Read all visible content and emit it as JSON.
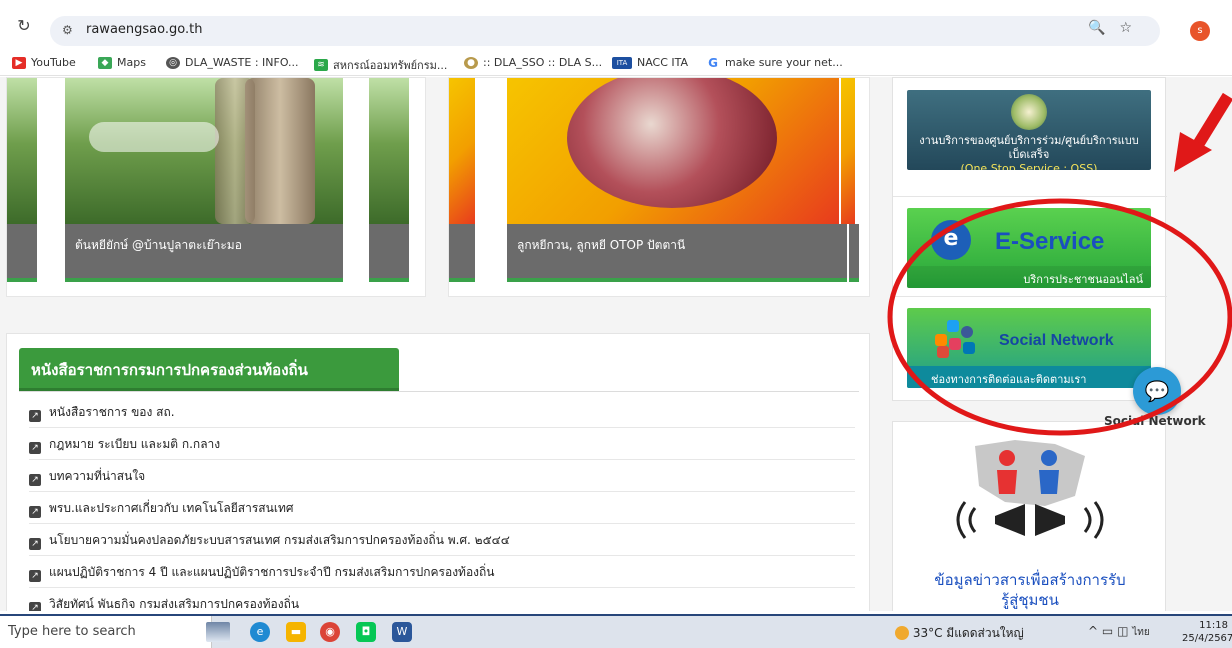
{
  "browser": {
    "url": "rawaengsao.go.th",
    "profile_initial": "s",
    "bookmarks": [
      "YouTube",
      "Maps",
      "DLA_WASTE : INFO...",
      "สหกรณ์ออมทรัพย์กรม...",
      ":: DLA_SSO :: DLA S...",
      "NACC ITA",
      "make sure your net..."
    ],
    "bookmark_badges": {
      "ita": "ITA",
      "google": "G"
    }
  },
  "cards": [
    {
      "caption": "ต้นหยียักษ์ @บ้านปูลาตะเย๊าะมอ"
    },
    {
      "caption": "ลูกหยีกวน, ลูกหยี OTOP ปัตตานี"
    }
  ],
  "panel": {
    "title": "หนังสือราชการกรมการปกครองส่วนท้องถิ่น",
    "items": [
      "หนังสือราชการ ของ สถ.",
      "กฎหมาย ระเบียบ และมติ ก.กลาง",
      "บทความที่น่าสนใจ",
      "พรบ.และประกาศเกี่ยวกับ เทคโนโลยีสารสนเทศ",
      "นโยบายความมั่นคงปลอดภัยระบบสารสนเทศ กรมส่งเสริมการปกครองท้องถิ่น พ.ศ. ๒๕๔๔",
      "แผนปฏิบัติราชการ 4 ปี และแผนปฏิบัติราชการประจำปี กรมส่งเสริมการปกครองท้องถิ่น",
      "วิสัยทัศน์ พันธกิจ กรมส่งเสริมการปกครองท้องถิ่น"
    ]
  },
  "sidebar": {
    "oss_text": "งานบริการของศูนย์บริการร่วม/ศูนย์บริการแบบเบ็ดเสร็จ",
    "oss_sub": "(One Stop Service : OSS)",
    "eservice_logo": "e",
    "eservice_title": "E-Service",
    "eservice_sub": "บริการประชาชนออนไลน์",
    "social_title": "Social Network",
    "social_sub": "ช่องทางการติดต่อและติดตามเรา",
    "info_text_1": "ข้อมูลข่าวสารเพื่อสร้างการรับ",
    "info_text_2": "รู้สู่ชุมชน"
  },
  "floating": {
    "label": "Social Network"
  },
  "taskbar": {
    "search_placeholder": "Type here to search",
    "weather": "33°C มีแดดส่วนใหญ่",
    "lang": "ไทย",
    "time": "11:18",
    "date": "25/4/2567"
  },
  "colors": {
    "accent_green": "#3b9a3d",
    "annotation_red": "#e01818",
    "taskbar_border": "#27467a"
  }
}
